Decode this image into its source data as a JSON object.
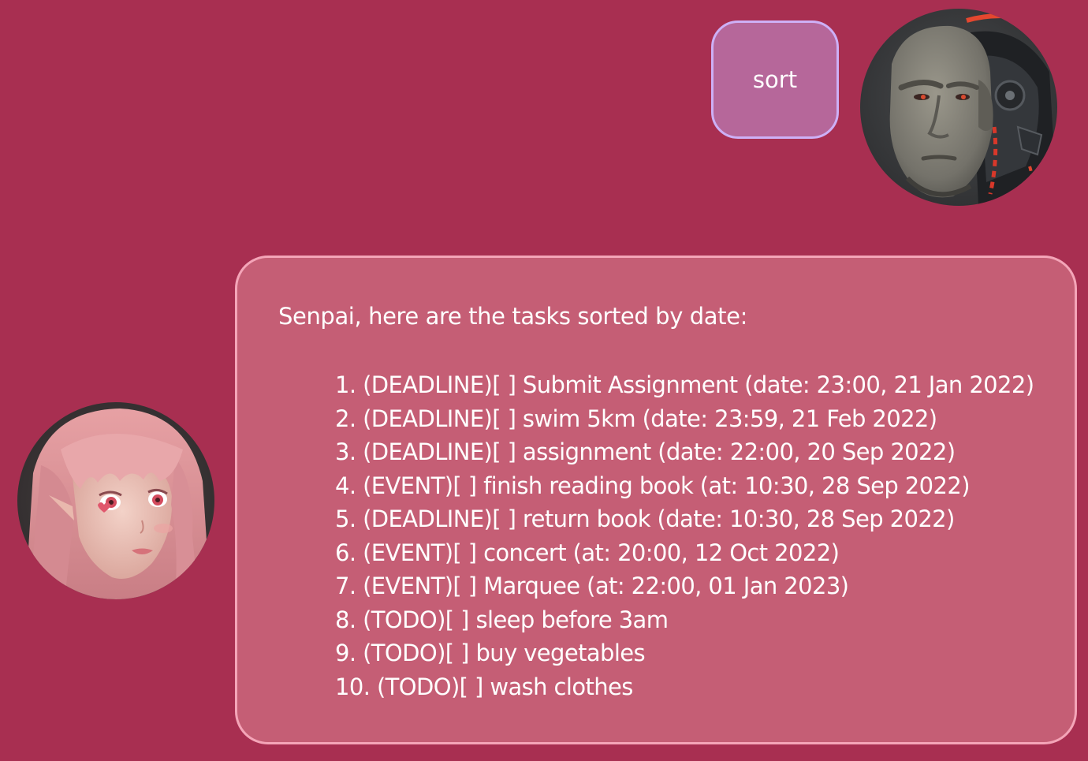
{
  "user_message": {
    "text": "sort",
    "avatar": "muscular-cyborg-man-avatar"
  },
  "bot_message": {
    "avatar": "pink-haired-girl-avatar",
    "intro": "Senpai, here are the tasks sorted by date:",
    "tasks": [
      "1. (DEADLINE)[ ] Submit Assignment (date: 23:00, 21 Jan 2022)",
      "2. (DEADLINE)[ ] swim 5km (date: 23:59, 21 Feb 2022)",
      "3. (DEADLINE)[ ] assignment (date: 22:00, 20 Sep 2022)",
      "4. (EVENT)[ ] finish reading book (at: 10:30, 28 Sep 2022)",
      "5. (DEADLINE)[ ] return book (date: 10:30, 28 Sep 2022)",
      "6. (EVENT)[ ] concert (at: 20:00, 12 Oct 2022)",
      "7. (EVENT)[ ] Marquee (at: 22:00, 01 Jan 2023)",
      "8. (TODO)[ ] sleep before 3am",
      "9. (TODO)[ ] buy vegetables",
      "10. (TODO)[ ] wash clothes"
    ]
  },
  "colors": {
    "background": "#a82f51",
    "user_bubble": "#b6679a",
    "user_bubble_border": "#cdb0f6",
    "bot_bubble": "#c55e75",
    "bot_bubble_border": "#f4a5b8",
    "text": "#ffffff"
  }
}
